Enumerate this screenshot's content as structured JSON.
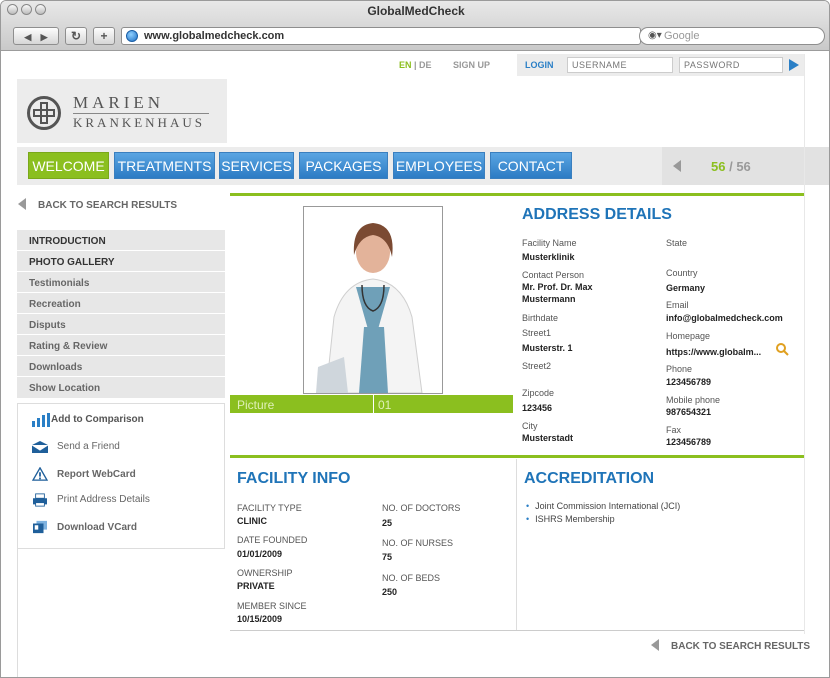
{
  "window": {
    "title": "GlobalMedCheck"
  },
  "browser": {
    "url": "www.globalmedcheck.com",
    "search_placeholder": "Google"
  },
  "topbar": {
    "lang_en": "EN",
    "lang_sep": " | ",
    "lang_de": "DE",
    "signup": "SIGN UP",
    "login": "LOGIN",
    "username_placeholder": "USERNAME",
    "password_placeholder": "PASSWORD"
  },
  "logo": {
    "line1": "MARIEN",
    "line2": "KRANKENHAUS"
  },
  "nav": {
    "tabs": [
      "WELCOME",
      "TREATMENTS",
      "SERVICES",
      "PACKAGES",
      "EMPLOYEES",
      "CONTACT"
    ],
    "active": "WELCOME",
    "pager_current": "56",
    "pager_total": "/ 56"
  },
  "back_label": "BACK TO SEARCH RESULTS",
  "sidebar": {
    "menu": [
      "INTRODUCTION",
      "PHOTO GALLERY",
      "Testimonials",
      "Recreation",
      "Disputs",
      "Rating & Review",
      "Downloads",
      "Show Location"
    ],
    "actions": [
      "Add to Comparison",
      "Send a Friend",
      "Report WebCard",
      "Print Address Details",
      "Download VCard"
    ]
  },
  "picture": {
    "label": "Picture",
    "number": "01"
  },
  "address": {
    "heading": "ADDRESS DETAILS",
    "facility_name_label": "Facility Name",
    "facility_name": "Musterklinik",
    "contact_label": "Contact Person",
    "contact_line1": "Mr. Prof. Dr. Max",
    "contact_line2": "Mustermann",
    "birthdate_label": "Birthdate",
    "street1_label": "Street1",
    "street1": "Musterstr. 1",
    "street2_label": "Street2",
    "zip_label": "Zipcode",
    "zip": "123456",
    "city_label": "City",
    "city": "Musterstadt",
    "state_label": "State",
    "country_label": "Country",
    "country": "Germany",
    "email_label": "Email",
    "email": "info@globalmedcheck.com",
    "homepage_label": "Homepage",
    "homepage": "https://www.globalm...",
    "phone_label": "Phone",
    "phone": "123456789",
    "mobile_label": "Mobile phone",
    "mobile": "987654321",
    "fax_label": "Fax",
    "fax": "123456789"
  },
  "facility": {
    "heading": "FACILITY INFO",
    "type_label": "FACILITY TYPE",
    "type": "CLINIC",
    "founded_label": "DATE FOUNDED",
    "founded": "01/01/2009",
    "ownership_label": "OWNERSHIP",
    "ownership": "PRIVATE",
    "member_label": "MEMBER SINCE",
    "member": "10/15/2009",
    "doctors_label": "NO. OF DOCTORS",
    "doctors": "25",
    "nurses_label": "NO. OF NURSES",
    "nurses": "75",
    "beds_label": "NO. OF BEDS",
    "beds": "250"
  },
  "accreditation": {
    "heading": "ACCREDITATION",
    "items": [
      "Joint Commission International (JCI)",
      "ISHRS Membership"
    ]
  },
  "colors": {
    "green": "#8bbf1f",
    "blue": "#2c7bc4",
    "heading_blue": "#1f74b8"
  }
}
